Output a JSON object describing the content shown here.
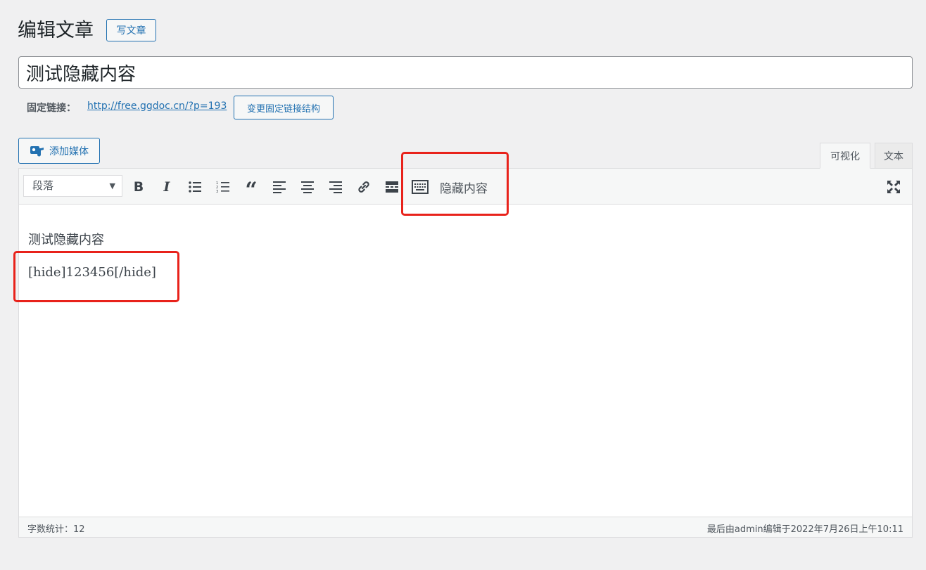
{
  "header": {
    "title": "编辑文章",
    "new_post_label": "写文章"
  },
  "post": {
    "title": "测试隐藏内容",
    "permalink_label": "固定链接：",
    "permalink_url": "http://free.ggdoc.cn/?p=193",
    "change_permalink_label": "变更固定链接结构"
  },
  "editor": {
    "add_media_label": "添加媒体",
    "tabs": [
      {
        "label": "可视化",
        "active": true
      },
      {
        "label": "文本",
        "active": false
      }
    ],
    "format_select": {
      "selected": "段落"
    },
    "toolbar_icons": [
      "bold-icon",
      "italic-icon",
      "bullet-list-icon",
      "numbered-list-icon",
      "blockquote-icon",
      "align-left-icon",
      "align-center-icon",
      "align-right-icon",
      "link-icon",
      "read-more-icon",
      "hide-content-icon",
      "fullscreen-icon"
    ],
    "hide_button_label": "隐藏内容",
    "content": [
      "测试隐藏内容",
      "[hide]123456[/hide]"
    ]
  },
  "status": {
    "word_count": "字数统计：12",
    "last_edited": "最后由admin编辑于2022年7月26日上午10:11"
  },
  "colors": {
    "accent": "#2271b1",
    "highlight": "#e8221b",
    "background": "#f0f0f1"
  }
}
